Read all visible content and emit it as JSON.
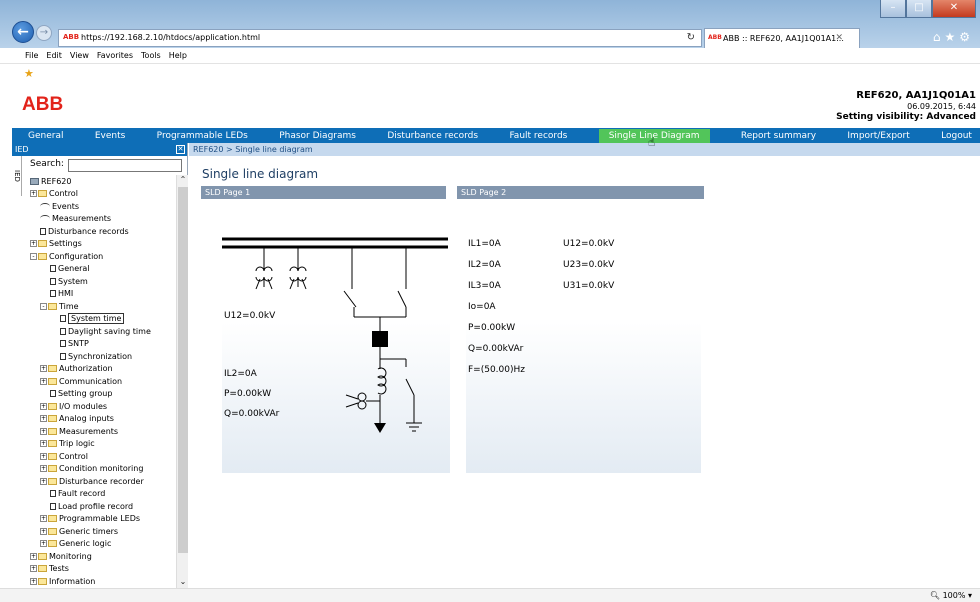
{
  "browser": {
    "url": "https://192.168.2.10/htdocs/application.html",
    "tab_title": "ABB :: REF620, AA1J1Q01A1...",
    "menu": [
      "File",
      "Edit",
      "View",
      "Favorites",
      "Tools",
      "Help"
    ],
    "zoom": "100%"
  },
  "header": {
    "logo": "ABB",
    "device": "REF620, AA1J1Q01A1",
    "datetime": "06.09.2015, 6:44",
    "visibility": "Setting visibility: Advanced"
  },
  "nav": [
    "General",
    "Events",
    "Programmable LEDs",
    "Phasor Diagrams",
    "Disturbance records",
    "Fault records",
    "Single Line Diagram",
    "Report summary",
    "Import/Export",
    "Logout"
  ],
  "nav_active": "Single Line Diagram",
  "tree_panel": {
    "title": "IED",
    "side_tab": "IED",
    "search_label": "Search:",
    "search_value": "",
    "items": [
      {
        "label": "REF620",
        "indent": 0,
        "icon": "root"
      },
      {
        "label": "Control",
        "indent": 0,
        "icon": "folder",
        "exp": "+"
      },
      {
        "label": "Events",
        "indent": 1,
        "icon": "wave"
      },
      {
        "label": "Measurements",
        "indent": 1,
        "icon": "wave"
      },
      {
        "label": "Disturbance records",
        "indent": 1,
        "icon": "page"
      },
      {
        "label": "Settings",
        "indent": 0,
        "icon": "folder",
        "exp": "+"
      },
      {
        "label": "Configuration",
        "indent": 0,
        "icon": "folder",
        "exp": "-"
      },
      {
        "label": "General",
        "indent": 2,
        "icon": "page"
      },
      {
        "label": "System",
        "indent": 2,
        "icon": "page"
      },
      {
        "label": "HMI",
        "indent": 2,
        "icon": "page"
      },
      {
        "label": "Time",
        "indent": 1,
        "icon": "folder",
        "exp": "-"
      },
      {
        "label": "System time",
        "indent": 3,
        "icon": "page",
        "selected": true
      },
      {
        "label": "Daylight saving time",
        "indent": 3,
        "icon": "page"
      },
      {
        "label": "SNTP",
        "indent": 3,
        "icon": "page"
      },
      {
        "label": "Synchronization",
        "indent": 3,
        "icon": "page"
      },
      {
        "label": "Authorization",
        "indent": 1,
        "icon": "folder",
        "exp": "+"
      },
      {
        "label": "Communication",
        "indent": 1,
        "icon": "folder",
        "exp": "+"
      },
      {
        "label": "Setting group",
        "indent": 2,
        "icon": "page"
      },
      {
        "label": "I/O modules",
        "indent": 1,
        "icon": "folder",
        "exp": "+"
      },
      {
        "label": "Analog inputs",
        "indent": 1,
        "icon": "folder",
        "exp": "+"
      },
      {
        "label": "Measurements",
        "indent": 1,
        "icon": "folder",
        "exp": "+"
      },
      {
        "label": "Trip logic",
        "indent": 1,
        "icon": "folder",
        "exp": "+"
      },
      {
        "label": "Control",
        "indent": 1,
        "icon": "folder",
        "exp": "+"
      },
      {
        "label": "Condition monitoring",
        "indent": 1,
        "icon": "folder",
        "exp": "+"
      },
      {
        "label": "Disturbance recorder",
        "indent": 1,
        "icon": "folder",
        "exp": "+"
      },
      {
        "label": "Fault record",
        "indent": 2,
        "icon": "page"
      },
      {
        "label": "Load profile record",
        "indent": 2,
        "icon": "page"
      },
      {
        "label": "Programmable LEDs",
        "indent": 1,
        "icon": "folder",
        "exp": "+"
      },
      {
        "label": "Generic timers",
        "indent": 1,
        "icon": "folder",
        "exp": "+"
      },
      {
        "label": "Generic logic",
        "indent": 1,
        "icon": "folder",
        "exp": "+"
      },
      {
        "label": "Monitoring",
        "indent": 0,
        "icon": "folder",
        "exp": "+"
      },
      {
        "label": "Tests",
        "indent": 0,
        "icon": "folder",
        "exp": "+"
      },
      {
        "label": "Information",
        "indent": 0,
        "icon": "folder",
        "exp": "+"
      }
    ]
  },
  "content": {
    "breadcrumb": "REF620 > Single line diagram",
    "title": "Single line diagram",
    "sld1": {
      "header": "SLD Page 1",
      "u12": "U12=0.0kV",
      "il2": "IL2=0A",
      "p": "P=0.00kW",
      "q": "Q=0.00kVAr"
    },
    "sld2": {
      "header": "SLD Page 2",
      "rows": [
        [
          "IL1=0A",
          "U12=0.0kV"
        ],
        [
          "IL2=0A",
          "U23=0.0kV"
        ],
        [
          "IL3=0A",
          "U31=0.0kV"
        ],
        [
          "Io=0A",
          ""
        ],
        [
          "P=0.00kW",
          ""
        ],
        [
          "Q=0.00kVAr",
          ""
        ],
        [
          "F=(50.00)Hz",
          ""
        ]
      ]
    }
  }
}
